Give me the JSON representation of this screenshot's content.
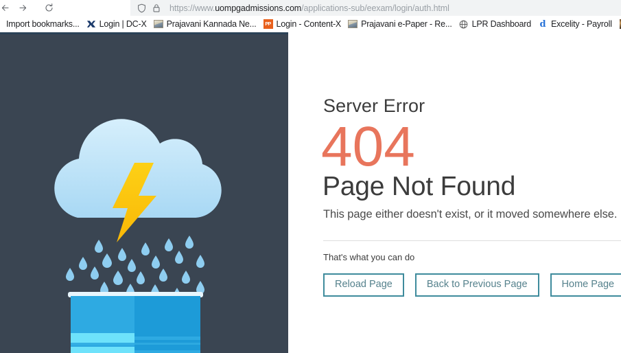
{
  "browser": {
    "nav": {
      "back_label": "Back",
      "back_icon": "arrow-left-icon",
      "forward_label": "Forward",
      "forward_icon": "arrow-right-icon",
      "reload_label": "Reload",
      "reload_icon": "reload-icon"
    },
    "omnibox": {
      "shield_icon": "shield-icon",
      "lock_icon": "lock-icon",
      "url_scheme": "https://www.",
      "url_host": "uompgadmissions.com",
      "url_path": "/applications-sub/eexam/login/auth.html",
      "url_full": "https://www.uompgadmissions.com/applications-sub/eexam/login/auth.html"
    },
    "bookmarks": [
      {
        "label": "Import bookmarks...",
        "icon": "none"
      },
      {
        "label": "Login | DC-X",
        "icon": "dcx-icon"
      },
      {
        "label": "Prajavani Kannada Ne...",
        "icon": "image-icon"
      },
      {
        "label": "Login - Content-X",
        "icon": "pp-icon"
      },
      {
        "label": "Prajavani e-Paper - Re...",
        "icon": "image-icon"
      },
      {
        "label": "LPR Dashboard",
        "icon": "globe-icon"
      },
      {
        "label": "Excelity - Payroll",
        "icon": "d-icon"
      },
      {
        "label": "",
        "icon": "photo-icon"
      }
    ]
  },
  "error_page": {
    "server_error_label": "Server Error",
    "code": "404",
    "title": "Page Not Found",
    "description": "This page either doesn't exist, or it moved somewhere else.",
    "suggestion": "That's what you can do",
    "buttons": [
      {
        "label": "Reload Page",
        "name": "reload-page-button"
      },
      {
        "label": "Back to Previous Page",
        "name": "back-to-previous-page-button"
      },
      {
        "label": "Home Page",
        "name": "home-page-button"
      }
    ],
    "colors": {
      "panel_background": "#3a4552",
      "error_code": "#e8755c",
      "button_border": "#3e8b9c",
      "button_text": "#55818c",
      "cloud": "#bfe4f8",
      "lightning": "#fbc00d",
      "raindrop": "#8ecdf0",
      "server_body": "#1d9bd8",
      "server_stripe": "#6ee2fb"
    },
    "illustration": {
      "name": "storm-cloud-over-server-illustration",
      "parts": [
        "cloud-icon",
        "lightning-bolt-icon",
        "raindrops",
        "server-rack"
      ]
    }
  }
}
